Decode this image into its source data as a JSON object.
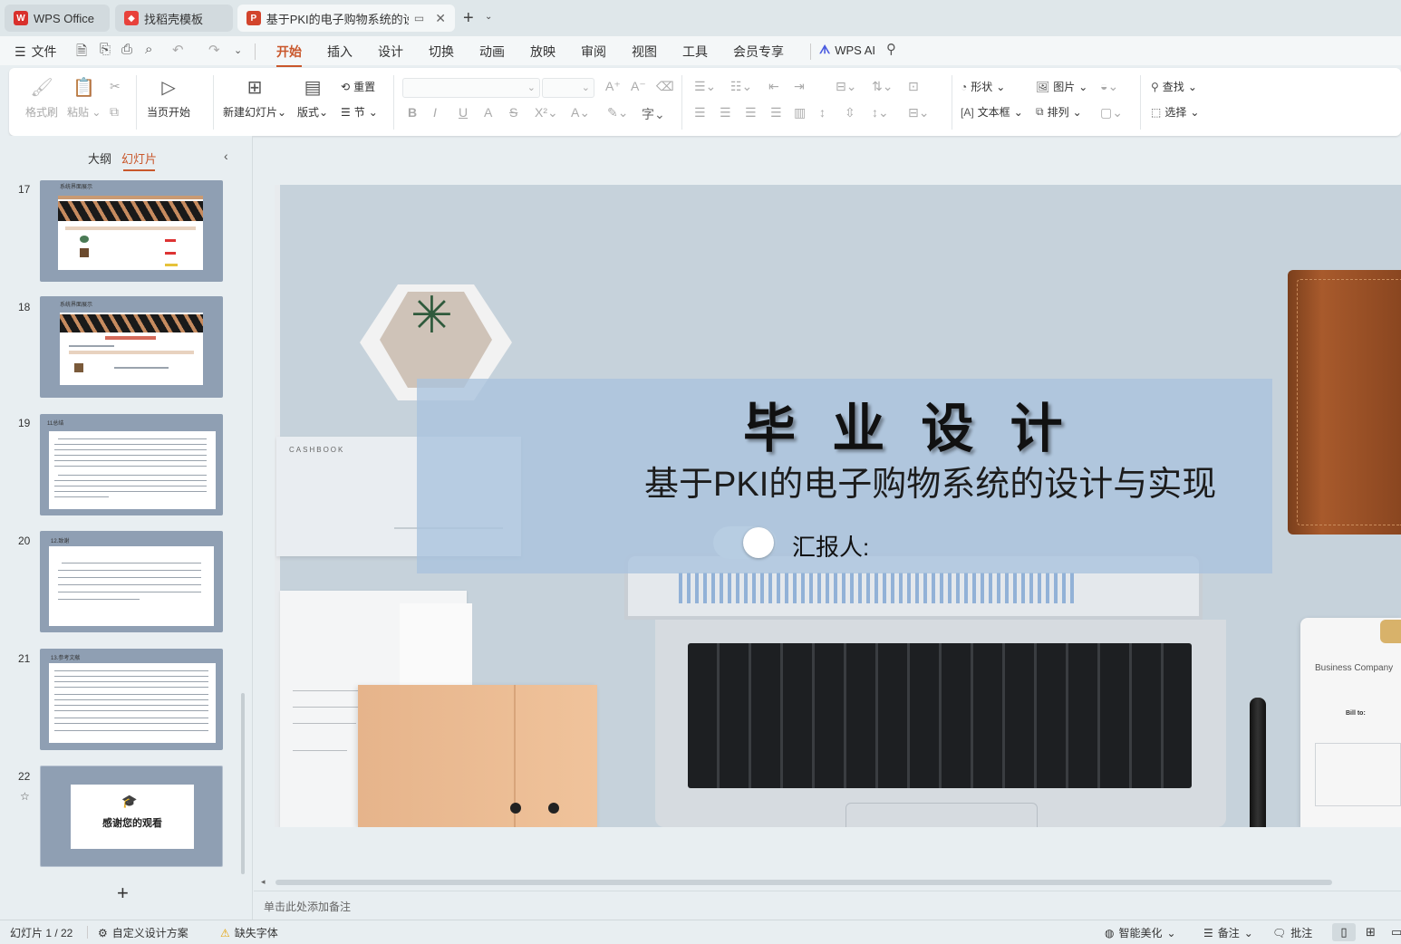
{
  "tabs": [
    {
      "label": "WPS Office",
      "icon": "wps-logo-icon"
    },
    {
      "label": "找稻壳模板",
      "icon": "docer-icon"
    },
    {
      "label": "基于PKI的电子购物系统的设计",
      "icon": "presentation-icon"
    }
  ],
  "menu": {
    "file_label": "文件",
    "items": [
      "开始",
      "插入",
      "设计",
      "切换",
      "动画",
      "放映",
      "审阅",
      "视图",
      "工具",
      "会员专享"
    ],
    "active": "开始",
    "ai_label": "WPS AI"
  },
  "ribbon": {
    "format_painter": "格式刷",
    "paste": "粘贴",
    "from_current": "当页开始",
    "new_slide": "新建幻灯片",
    "layout": "版式",
    "reset": "重置",
    "section": "节",
    "shape": "形状",
    "picture": "图片",
    "textbox": "文本框",
    "arrange": "排列",
    "find": "查找",
    "select": "选择"
  },
  "panel": {
    "tab_outline": "大纲",
    "tab_slides": "幻灯片",
    "slides": [
      {
        "num": "17",
        "title": "系统界面展示"
      },
      {
        "num": "18",
        "title": "系统界面展示"
      },
      {
        "num": "19",
        "title": "11总结"
      },
      {
        "num": "20",
        "title": "12.致谢"
      },
      {
        "num": "21",
        "title": "13.参考文献"
      },
      {
        "num": "22",
        "title": "感谢您的观看"
      }
    ],
    "add_label": "+"
  },
  "slide": {
    "title": "毕 业 设 计",
    "subtitle": "基于PKI的电子购物系统的设计与实现",
    "reporter": "汇报人:",
    "cashbook": "CASHBOOK",
    "card_title": "Business Company",
    "bill_to": "Bill to:"
  },
  "notes_placeholder": "单击此处添加备注",
  "status": {
    "slide_counter": "幻灯片 1 / 22",
    "custom_design": "自定义设计方案",
    "missing_font": "缺失字体",
    "beautify": "智能美化",
    "notes": "备注",
    "comment": "批注"
  },
  "colors": {
    "accent": "#c9572b",
    "slide_band": "#a9c3de"
  }
}
